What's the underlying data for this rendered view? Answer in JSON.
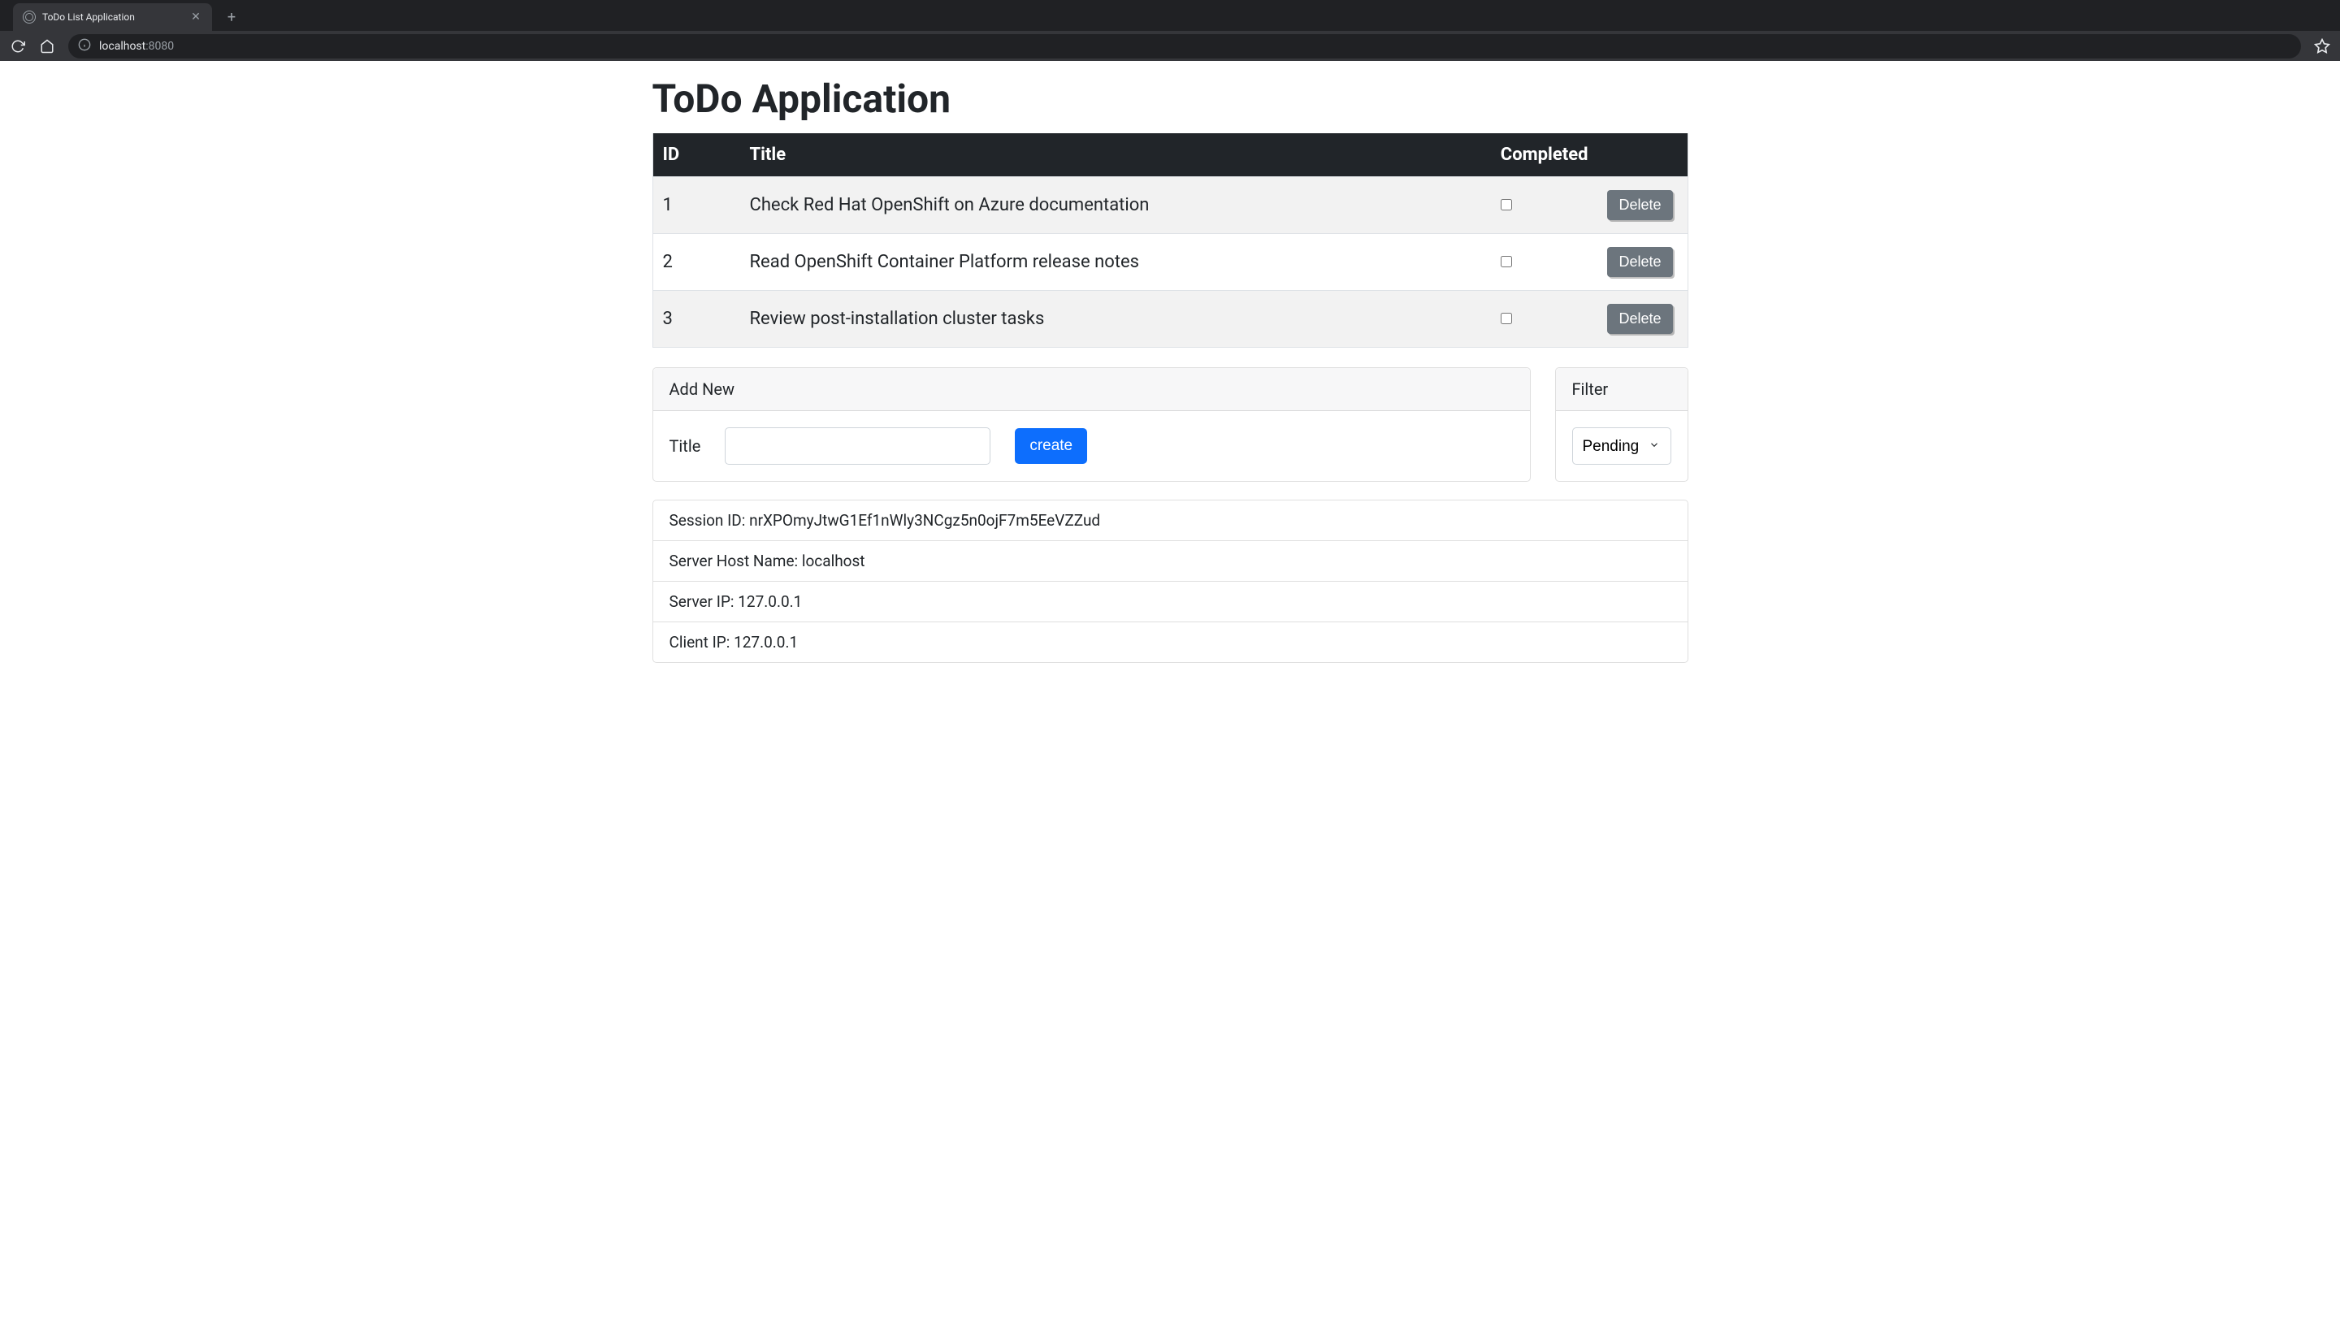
{
  "browser": {
    "tab_title": "ToDo List Application",
    "url_host": "localhost",
    "url_port": ":8080"
  },
  "app": {
    "heading": "ToDo Application"
  },
  "table": {
    "headers": {
      "id": "ID",
      "title": "Title",
      "completed": "Completed"
    },
    "delete_label": "Delete",
    "rows": [
      {
        "id": "1",
        "title": "Check Red Hat OpenShift on Azure documentation",
        "completed": false
      },
      {
        "id": "2",
        "title": "Read OpenShift Container Platform release notes",
        "completed": false
      },
      {
        "id": "3",
        "title": "Review post-installation cluster tasks",
        "completed": false
      }
    ]
  },
  "add_card": {
    "header": "Add New",
    "title_label": "Title",
    "title_value": "",
    "create_label": "create"
  },
  "filter_card": {
    "header": "Filter",
    "selected": "Pending"
  },
  "info": {
    "session_label": "Session ID: ",
    "session_value": "nrXPOmyJtwG1Ef1nWly3NCgz5n0ojF7m5EeVZZud",
    "server_host_label": "Server Host Name: ",
    "server_host_value": "localhost",
    "server_ip_label": "Server IP: ",
    "server_ip_value": "127.0.0.1",
    "client_ip_label": "Client IP: ",
    "client_ip_value": "127.0.0.1"
  }
}
